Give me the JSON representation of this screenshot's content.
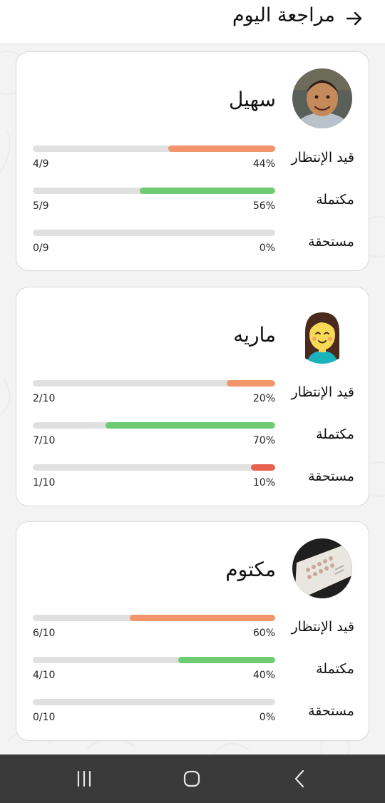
{
  "header": {
    "title": "مراجعة اليوم",
    "back_icon": "arrow-right-icon"
  },
  "colors": {
    "pending": "#f2956b",
    "completed": "#6fcb73",
    "overdue": "#e8604f",
    "track": "#e0e0e0"
  },
  "students": [
    {
      "name": "سهيل",
      "avatar": "child-photo-avatar",
      "stats": [
        {
          "label": "قيد الإنتظار",
          "percent": "44%",
          "fraction": "4/9",
          "value": 0.44,
          "kind": "pending"
        },
        {
          "label": "مكتملة",
          "percent": "56%",
          "fraction": "5/9",
          "value": 0.56,
          "kind": "completed"
        },
        {
          "label": "مستحقة",
          "percent": "0%",
          "fraction": "0/9",
          "value": 0,
          "kind": "overdue"
        }
      ]
    },
    {
      "name": "ماريه",
      "avatar": "girl-cartoon-avatar",
      "stats": [
        {
          "label": "قيد الإنتظار",
          "percent": "20%",
          "fraction": "2/10",
          "value": 0.2,
          "kind": "pending"
        },
        {
          "label": "مكتملة",
          "percent": "70%",
          "fraction": "7/10",
          "value": 0.7,
          "kind": "completed"
        },
        {
          "label": "مستحقة",
          "percent": "10%",
          "fraction": "1/10",
          "value": 0.1,
          "kind": "overdue"
        }
      ]
    },
    {
      "name": "مكتوم",
      "avatar": "tablet-photo-avatar",
      "stats": [
        {
          "label": "قيد الإنتظار",
          "percent": "60%",
          "fraction": "6/10",
          "value": 0.6,
          "kind": "pending"
        },
        {
          "label": "مكتملة",
          "percent": "40%",
          "fraction": "4/10",
          "value": 0.4,
          "kind": "completed"
        },
        {
          "label": "مستحقة",
          "percent": "0%",
          "fraction": "0/10",
          "value": 0,
          "kind": "overdue"
        }
      ]
    }
  ],
  "navbar": {
    "recent_icon": "recent-apps-icon",
    "home_icon": "home-icon",
    "back_icon": "back-icon"
  }
}
